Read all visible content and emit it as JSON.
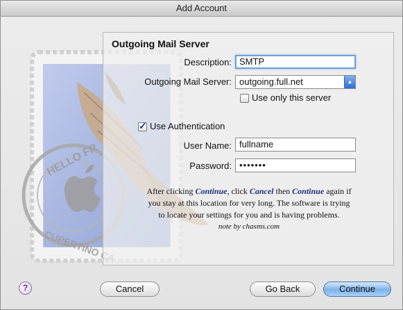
{
  "window": {
    "title": "Add Account"
  },
  "section": {
    "heading": "Outgoing Mail Server"
  },
  "form": {
    "description_label": "Description:",
    "description_value": "SMTP",
    "server_label": "Outgoing Mail Server:",
    "server_value": "outgoing.full.net",
    "use_only_label": "Use only this server",
    "use_only_checked": false,
    "use_auth_label": "Use Authentication",
    "use_auth_checked": true,
    "username_label": "User Name:",
    "username_value": "fullname",
    "password_label": "Password:",
    "password_value": "•••••••"
  },
  "note": {
    "line1_a": "After clicking ",
    "line1_b": "Continue",
    "line1_c": ", click ",
    "line1_d": "Cancel",
    "line1_e": " then ",
    "line1_f": "Continue",
    "line1_g": " again if",
    "line2": "you stay at this location for very long. The software is trying",
    "line3": "to locate your settings for you and is having problems.",
    "signature": "note by chasms.com"
  },
  "stamp": {
    "top_text": "HELLO FR",
    "bottom_text": "CUPERTINO CA"
  },
  "buttons": {
    "help": "?",
    "cancel": "Cancel",
    "go_back": "Go Back",
    "continue": "Continue"
  },
  "icons": {
    "help": "question-mark-icon",
    "popup": "popup-arrows-icon",
    "checkbox": "checkmark-icon",
    "background": "mail-stamp-eagle-icon"
  }
}
